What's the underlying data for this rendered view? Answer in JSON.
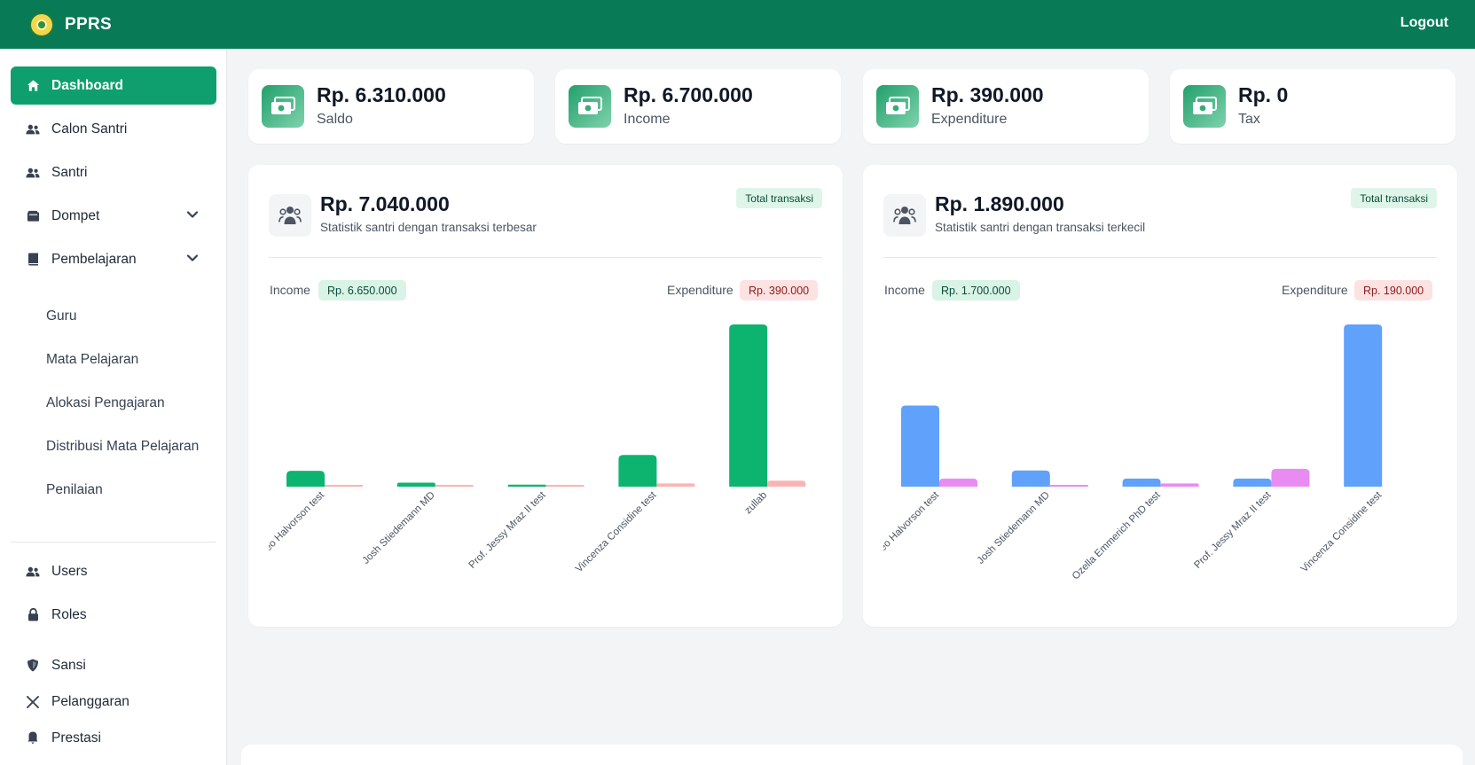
{
  "app": {
    "name": "PPRS",
    "logout_label": "Logout"
  },
  "sidebar": {
    "items": [
      {
        "label": "Dashboard",
        "icon": "home-icon"
      },
      {
        "label": "Calon Santri",
        "icon": "users-icon"
      },
      {
        "label": "Santri",
        "icon": "users-icon"
      },
      {
        "label": "Dompet",
        "icon": "wallet-icon"
      },
      {
        "label": "Pembelajaran",
        "icon": "book-icon"
      }
    ],
    "sub_items": [
      "Guru",
      "Mata Pelajaran",
      "Alokasi Pengajaran",
      "Distribusi Mata Pelajaran",
      "Penilaian"
    ],
    "bottom_items": [
      {
        "label": "Users",
        "icon": "users-icon"
      },
      {
        "label": "Roles",
        "icon": "lock-icon"
      },
      {
        "label": "Sansi",
        "icon": "shield-icon"
      },
      {
        "label": "Pelanggaran",
        "icon": "x-icon"
      },
      {
        "label": "Prestasi",
        "icon": "award-icon"
      }
    ]
  },
  "stats": [
    {
      "value": "Rp. 6.310.000",
      "label": "Saldo",
      "icon": "money-icon"
    },
    {
      "value": "Rp. 6.700.000",
      "label": "Income",
      "icon": "money-icon"
    },
    {
      "value": "Rp. 390.000",
      "label": "Expenditure",
      "icon": "money-icon"
    },
    {
      "value": "Rp. 0",
      "label": "Tax",
      "icon": "money-icon"
    }
  ],
  "cards": [
    {
      "value": "Rp. 7.040.000",
      "subtitle": "Statistik santri dengan transaksi terbesar",
      "badge": "Total transaksi",
      "income_label": "Income",
      "income_value": "Rp. 6.650.000",
      "expenditure_label": "Expenditure",
      "expenditure_value": "Rp. 390.000",
      "icon": "users-group-icon"
    },
    {
      "value": "Rp. 1.890.000",
      "subtitle": "Statistik santri dengan transaksi terkecil",
      "badge": "Total transaksi",
      "income_label": "Income",
      "income_value": "Rp. 1.700.000",
      "expenditure_label": "Expenditure",
      "expenditure_value": "Rp. 190.000",
      "icon": "users-group-icon"
    }
  ],
  "colors": {
    "primary": "#087a55",
    "active": "#0f9f6e",
    "chart1_income": "#0db46f",
    "chart1_expenditure": "#fbb4b4",
    "chart2_income": "#60a1fb",
    "chart2_expenditure": "#e88cf2"
  },
  "chart_data": [
    {
      "type": "bar",
      "categories": [
        "Leo Halvorson test",
        "Josh Stiedemann MD",
        "Prof. Jessy Mraz II test",
        "Vincenza Considine test",
        "zullab"
      ],
      "series": [
        {
          "name": "Income",
          "values": [
            400000,
            100000,
            50000,
            800000,
            4100000
          ]
        },
        {
          "name": "Expenditure",
          "values": [
            30000,
            10000,
            10000,
            80000,
            150000
          ]
        }
      ],
      "ylim": [
        0,
        4100000
      ]
    },
    {
      "type": "bar",
      "categories": [
        "Leo Halvorson test",
        "Josh Stiedemann MD",
        "Ozella Emmerich PhD test",
        "Prof. Jessy Mraz II test",
        "Vincenza Considine test"
      ],
      "series": [
        {
          "name": "Income",
          "values": [
            500000,
            100000,
            50000,
            50000,
            1000000
          ]
        },
        {
          "name": "Expenditure",
          "values": [
            50000,
            10000,
            20000,
            110000,
            0
          ]
        }
      ],
      "ylim": [
        0,
        1000000
      ]
    }
  ]
}
